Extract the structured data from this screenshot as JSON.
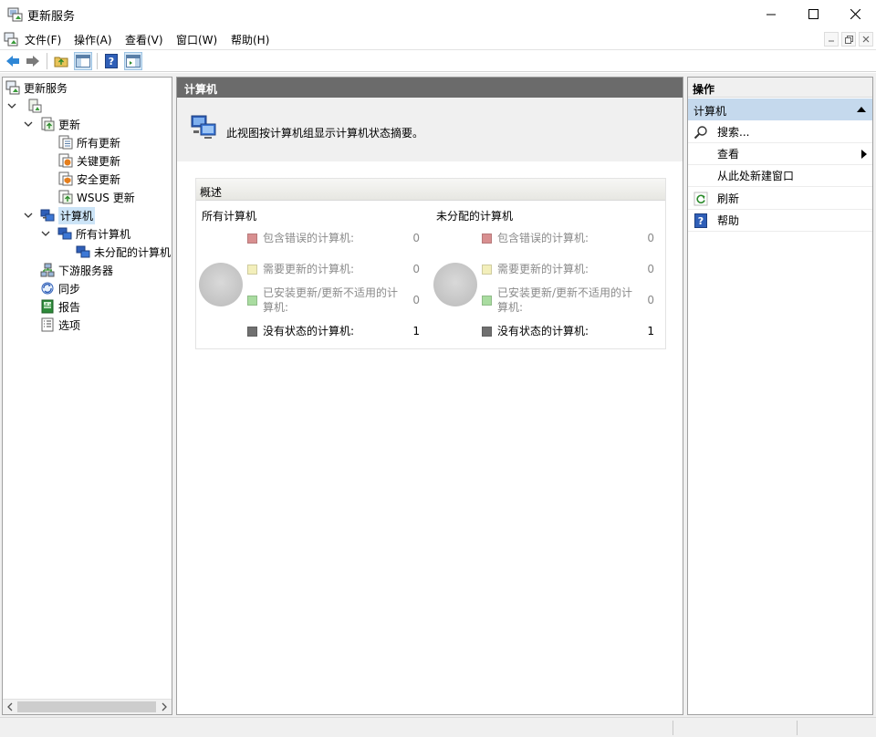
{
  "window": {
    "title": "更新服务"
  },
  "menu": [
    "文件(F)",
    "操作(A)",
    "查看(V)",
    "窗口(W)",
    "帮助(H)"
  ],
  "tree": {
    "root": "更新服务",
    "updates": "更新",
    "all_updates": "所有更新",
    "critical_updates": "关键更新",
    "security_updates": "安全更新",
    "wsus_updates": "WSUS 更新",
    "computers": "计算机",
    "all_computers": "所有计算机",
    "unassigned_computers": "未分配的计算机",
    "downstream": "下游服务器",
    "sync": "同步",
    "reports": "报告",
    "options": "选项"
  },
  "main": {
    "header": "计算机",
    "banner_text": "此视图按计算机组显示计算机状态摘要。",
    "overview_title": "概述",
    "columns": [
      {
        "title": "所有计算机",
        "legend": [
          {
            "label": "包含错误的计算机:",
            "value": "0",
            "color": "#d88f90"
          },
          {
            "label": "需要更新的计算机:",
            "value": "0",
            "color": "#f3efbb"
          },
          {
            "label": "已安装更新/更新不适用的计算机:",
            "value": "0",
            "color": "#a9dca0"
          },
          {
            "label": "没有状态的计算机:",
            "value": "1",
            "color": "#707070"
          }
        ]
      },
      {
        "title": "未分配的计算机",
        "legend": [
          {
            "label": "包含错误的计算机:",
            "value": "0",
            "color": "#d88f90"
          },
          {
            "label": "需要更新的计算机:",
            "value": "0",
            "color": "#f3efbb"
          },
          {
            "label": "已安装更新/更新不适用的计算机:",
            "value": "0",
            "color": "#a9dca0"
          },
          {
            "label": "没有状态的计算机:",
            "value": "1",
            "color": "#707070"
          }
        ]
      }
    ]
  },
  "actions": {
    "header": "操作",
    "section": "计算机",
    "items": [
      "搜索...",
      "查看",
      "从此处新建窗口",
      "刷新",
      "帮助"
    ]
  }
}
